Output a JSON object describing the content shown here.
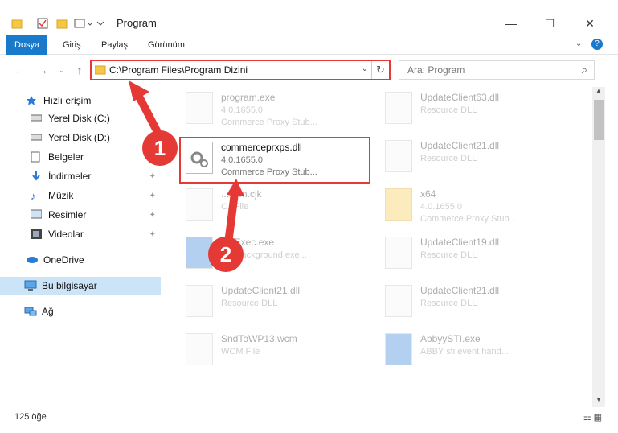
{
  "window": {
    "title": "Program"
  },
  "ribbon": {
    "tabs": [
      "Dosya",
      "Giriş",
      "Paylaş",
      "Görünüm"
    ]
  },
  "address": {
    "path": "C:\\Program Files\\Program Dizini"
  },
  "search": {
    "placeholder": "Ara: Program"
  },
  "sidebar": {
    "items": [
      {
        "label": "Hızlı erişim",
        "icon": "star-icon"
      },
      {
        "label": "Yerel Disk (C:)",
        "icon": "drive-icon"
      },
      {
        "label": "Yerel Disk (D:)",
        "icon": "drive-icon"
      },
      {
        "label": "Belgeler",
        "icon": "documents-icon"
      },
      {
        "label": "İndirmeler",
        "icon": "download-icon"
      },
      {
        "label": "Müzik",
        "icon": "music-icon"
      },
      {
        "label": "Resimler",
        "icon": "pictures-icon"
      },
      {
        "label": "Videolar",
        "icon": "video-icon"
      },
      {
        "label": "OneDrive",
        "icon": "cloud-icon"
      },
      {
        "label": "Bu bilgisayar",
        "icon": "computer-icon"
      },
      {
        "label": "Ağ",
        "icon": "network-icon"
      }
    ]
  },
  "files": [
    {
      "name": "program.exe",
      "version": "4.0.1655.0",
      "desc": "Commerce Proxy Stub..."
    },
    {
      "name": "UpdateClient63.dll",
      "version": "",
      "desc": "Resource DLL"
    },
    {
      "name": "commerceprxps.dll",
      "version": "4.0.1655.0",
      "desc": "Commerce Proxy Stub..."
    },
    {
      "name": "UpdateClient21.dll",
      "version": "",
      "desc": "Resource DLL"
    },
    {
      "name": "...com.cjk",
      "version": "",
      "desc": "CJ File"
    },
    {
      "name": "x64",
      "version": "4.0.1655.0",
      "desc": "Commerce Proxy Stub..."
    },
    {
      "name": "...eExec.exe",
      "version": "",
      "desc": "...Y background exe..."
    },
    {
      "name": "UpdateClient19.dll",
      "version": "",
      "desc": "Resource DLL"
    },
    {
      "name": "UpdateClient21.dll",
      "version": "",
      "desc": "Resource DLL"
    },
    {
      "name": "UpdateClient21.dll",
      "version": "",
      "desc": "Resource DLL"
    },
    {
      "name": "SndToWP13.wcm",
      "version": "",
      "desc": "WCM File"
    },
    {
      "name": "AbbyySTI.exe",
      "version": "",
      "desc": "ABBY sti event hand..."
    }
  ],
  "status": {
    "count": "125 öğe"
  },
  "annotations": {
    "step1": "1",
    "step2": "2"
  },
  "colors": {
    "accent": "#1979ca",
    "highlight": "#e53935"
  }
}
